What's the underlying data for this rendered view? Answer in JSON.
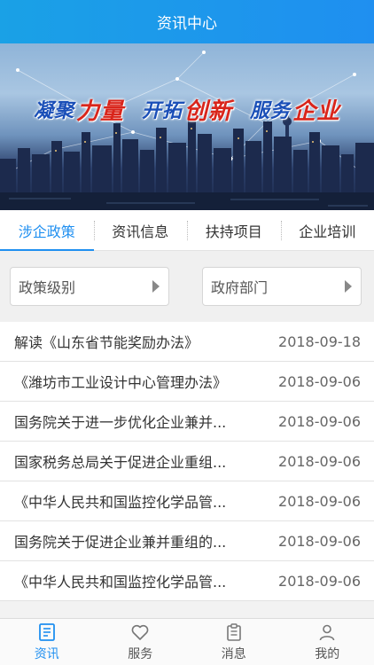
{
  "header": {
    "title": "资讯中心"
  },
  "banner": {
    "slogan": [
      {
        "text": "凝聚",
        "style": "blue"
      },
      {
        "text": "力量",
        "style": "red"
      },
      {
        "text": "开拓",
        "style": "blue"
      },
      {
        "text": "创新",
        "style": "red"
      },
      {
        "text": "服务",
        "style": "blue"
      },
      {
        "text": "企业",
        "style": "red"
      }
    ]
  },
  "tabs": [
    {
      "label": "涉企政策",
      "active": true
    },
    {
      "label": "资讯信息",
      "active": false
    },
    {
      "label": "扶持项目",
      "active": false
    },
    {
      "label": "企业培训",
      "active": false
    }
  ],
  "filters": {
    "level": "政策级别",
    "department": "政府部门"
  },
  "articles": [
    {
      "title": "解读《山东省节能奖励办法》",
      "date": "2018-09-18"
    },
    {
      "title": "《潍坊市工业设计中心管理办法》",
      "date": "2018-09-06"
    },
    {
      "title": "国务院关于进一步优化企业兼并...",
      "date": "2018-09-06"
    },
    {
      "title": "国家税务总局关于促进企业重组...",
      "date": "2018-09-06"
    },
    {
      "title": "《中华人民共和国监控化学品管...",
      "date": "2018-09-06"
    },
    {
      "title": "国务院关于促进企业兼并重组的...",
      "date": "2018-09-06"
    },
    {
      "title": "《中华人民共和国监控化学品管...",
      "date": "2018-09-06"
    }
  ],
  "tabbar": [
    {
      "label": "资讯",
      "icon": "news-icon",
      "active": true
    },
    {
      "label": "服务",
      "icon": "heart-icon",
      "active": false
    },
    {
      "label": "消息",
      "icon": "clipboard-icon",
      "active": false
    },
    {
      "label": "我的",
      "icon": "person-icon",
      "active": false
    }
  ],
  "colors": {
    "accent": "#1f8ff0",
    "header": "#1aa1e6"
  }
}
